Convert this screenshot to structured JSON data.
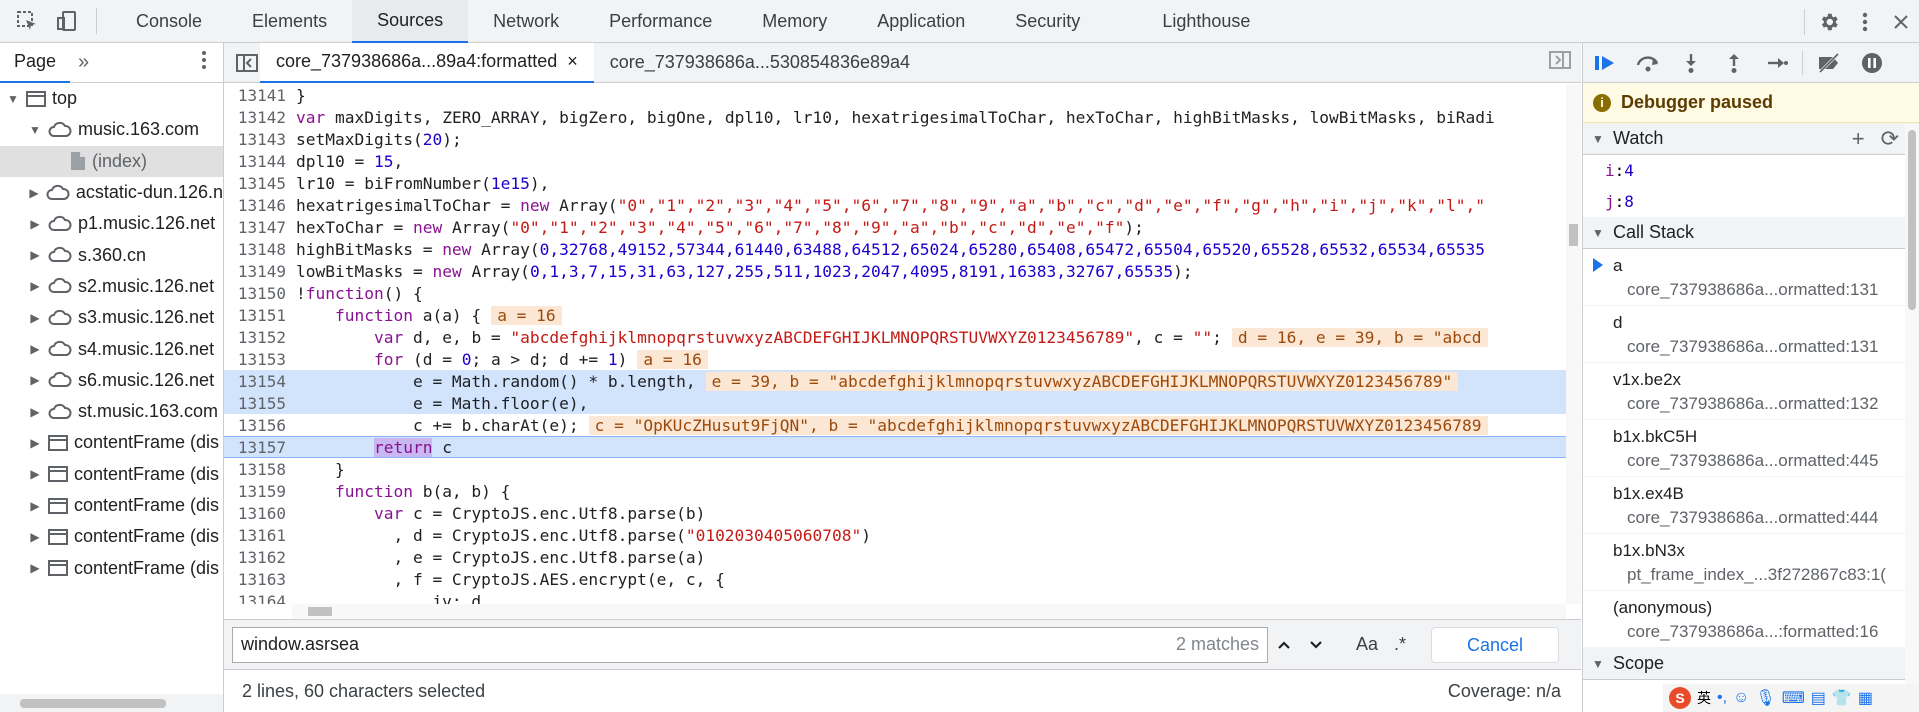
{
  "toolbar": {
    "tabs": [
      "Console",
      "Elements",
      "Sources",
      "Network",
      "Performance",
      "Memory",
      "Application",
      "Security",
      "Lighthouse"
    ],
    "active_tab": "Sources"
  },
  "navigator": {
    "tab_label": "Page",
    "more_label": "»",
    "items": [
      {
        "label": "top",
        "icon": "frame-icon",
        "expanded": true,
        "indent": 0
      },
      {
        "label": "music.163.com",
        "icon": "cloud-icon",
        "expanded": true,
        "indent": 1
      },
      {
        "label": "(index)",
        "icon": "file-icon",
        "expanded": null,
        "indent": 2
      },
      {
        "label": "acstatic-dun.126.n",
        "icon": "cloud-icon",
        "expanded": false,
        "indent": 1
      },
      {
        "label": "p1.music.126.net",
        "icon": "cloud-icon",
        "expanded": false,
        "indent": 1
      },
      {
        "label": "s.360.cn",
        "icon": "cloud-icon",
        "expanded": false,
        "indent": 1
      },
      {
        "label": "s2.music.126.net",
        "icon": "cloud-icon",
        "expanded": false,
        "indent": 1
      },
      {
        "label": "s3.music.126.net",
        "icon": "cloud-icon",
        "expanded": false,
        "indent": 1
      },
      {
        "label": "s4.music.126.net",
        "icon": "cloud-icon",
        "expanded": false,
        "indent": 1
      },
      {
        "label": "s6.music.126.net",
        "icon": "cloud-icon",
        "expanded": false,
        "indent": 1
      },
      {
        "label": "st.music.163.com",
        "icon": "cloud-icon",
        "expanded": false,
        "indent": 1
      },
      {
        "label": "contentFrame (dis",
        "icon": "frame-icon",
        "expanded": false,
        "indent": 1
      },
      {
        "label": "contentFrame (dis",
        "icon": "frame-icon",
        "expanded": false,
        "indent": 1
      },
      {
        "label": "contentFrame (dis",
        "icon": "frame-icon",
        "expanded": false,
        "indent": 1
      },
      {
        "label": "contentFrame (dis",
        "icon": "frame-icon",
        "expanded": false,
        "indent": 1
      },
      {
        "label": "contentFrame (dis",
        "icon": "frame-icon",
        "expanded": false,
        "indent": 1
      }
    ]
  },
  "editor": {
    "tabs": [
      {
        "label": "core_737938686a...89a4:formatted",
        "active": true,
        "closable": true
      },
      {
        "label": "core_737938686a...530854836e89a4",
        "active": false,
        "closable": false
      }
    ],
    "lines": [
      {
        "n": "13141",
        "segs": [
          [
            "}",
            "var"
          ]
        ]
      },
      {
        "n": "13142",
        "segs": [
          [
            "var",
            "kw"
          ],
          [
            " maxDigits, ZERO_ARRAY, bigZero, bigOne, dpl10, lr10, hexatrigesimalToChar, hexToChar, highBitMasks, lowBitMasks, biRadi",
            "var"
          ]
        ]
      },
      {
        "n": "13143",
        "segs": [
          [
            "setMaxDigits(",
            "var"
          ],
          [
            "20",
            "num"
          ],
          [
            ");",
            "var"
          ]
        ]
      },
      {
        "n": "13144",
        "segs": [
          [
            "dpl10 = ",
            "var"
          ],
          [
            "15",
            "num"
          ],
          [
            ",",
            "var"
          ]
        ]
      },
      {
        "n": "13145",
        "segs": [
          [
            "lr10 = biFromNumber(",
            "var"
          ],
          [
            "1e15",
            "num"
          ],
          [
            "),",
            "var"
          ]
        ]
      },
      {
        "n": "13146",
        "segs": [
          [
            "hexatrigesimalToChar = ",
            "var"
          ],
          [
            "new",
            "kw"
          ],
          [
            " Array(",
            "var"
          ],
          [
            "\"0\",\"1\",\"2\",\"3\",\"4\",\"5\",\"6\",\"7\",\"8\",\"9\",\"a\",\"b\",\"c\",\"d\",\"e\",\"f\",\"g\",\"h\",\"i\",\"j\",\"k\",\"l\",\"",
            "str"
          ]
        ]
      },
      {
        "n": "13147",
        "segs": [
          [
            "hexToChar = ",
            "var"
          ],
          [
            "new",
            "kw"
          ],
          [
            " Array(",
            "var"
          ],
          [
            "\"0\",\"1\",\"2\",\"3\",\"4\",\"5\",\"6\",\"7\",\"8\",\"9\",\"a\",\"b\",\"c\",\"d\",\"e\",\"f\"",
            "str"
          ],
          [
            ");",
            "var"
          ]
        ]
      },
      {
        "n": "13148",
        "segs": [
          [
            "highBitMasks = ",
            "var"
          ],
          [
            "new",
            "kw"
          ],
          [
            " Array(",
            "var"
          ],
          [
            "0,32768,49152,57344,61440,63488,64512,65024,65280,65408,65472,65504,65520,65528,65532,65534,65535",
            "num"
          ]
        ]
      },
      {
        "n": "13149",
        "segs": [
          [
            "lowBitMasks = ",
            "var"
          ],
          [
            "new",
            "kw"
          ],
          [
            " Array(",
            "var"
          ],
          [
            "0,1,3,7,15,31,63,127,255,511,1023,2047,4095,8191,16383,32767,65535",
            "num"
          ],
          [
            ");",
            "var"
          ]
        ]
      },
      {
        "n": "13150",
        "segs": [
          [
            "!",
            "var"
          ],
          [
            "function",
            "kw"
          ],
          [
            "() {",
            "var"
          ]
        ]
      },
      {
        "n": "13151",
        "segs": [
          [
            "    ",
            "var"
          ],
          [
            "function",
            "kw"
          ],
          [
            " a(a) {",
            "var"
          ]
        ],
        "inline": "a = 16"
      },
      {
        "n": "13152",
        "segs": [
          [
            "        ",
            "var"
          ],
          [
            "var",
            "kw"
          ],
          [
            " d, e, b = ",
            "var"
          ],
          [
            "\"abcdefghijklmnopqrstuvwxyzABCDEFGHIJKLMNOPQRSTUVWXYZ0123456789\"",
            "str"
          ],
          [
            ", c = ",
            "var"
          ],
          [
            "\"\"",
            "str"
          ],
          [
            ";",
            "var"
          ]
        ],
        "inline": "d = 16, e = 39, b = \"abcd"
      },
      {
        "n": "13153",
        "segs": [
          [
            "        ",
            "var"
          ],
          [
            "for",
            "kw"
          ],
          [
            " (d = ",
            "var"
          ],
          [
            "0",
            "num"
          ],
          [
            "; a > d; d += ",
            "var"
          ],
          [
            "1",
            "num"
          ],
          [
            ")",
            "var"
          ]
        ],
        "inline": "a = 16"
      },
      {
        "n": "13154",
        "segs": [
          [
            "            e = Math.random() * b.length,",
            "var"
          ]
        ],
        "inline": "e = 39, b = \"abcdefghijklmnopqrstuvwxyzABCDEFGHIJKLMNOPQRSTUVWXYZ0123456789\"",
        "hl": "partial"
      },
      {
        "n": "13155",
        "segs": [
          [
            "            e = Math.floor(e),",
            "var"
          ]
        ],
        "hl": "full"
      },
      {
        "n": "13156",
        "segs": [
          [
            "            c += b.charAt(e);",
            "var"
          ]
        ],
        "inline": "c = \"OpKUcZHusut9FjQN\", b = \"abcdefghijklmnopqrstuvwxyzABCDEFGHIJKLMNOPQRSTUVWXYZ0123456789"
      },
      {
        "n": "13157",
        "segs": [
          [
            "        ",
            "var"
          ],
          [
            "return",
            "kwhl"
          ],
          [
            " c",
            "var"
          ]
        ],
        "hl": "cur"
      },
      {
        "n": "13158",
        "segs": [
          [
            "    }",
            "var"
          ]
        ]
      },
      {
        "n": "13159",
        "segs": [
          [
            "    ",
            "var"
          ],
          [
            "function",
            "kw"
          ],
          [
            " b(a, b) {",
            "var"
          ]
        ]
      },
      {
        "n": "13160",
        "segs": [
          [
            "        ",
            "var"
          ],
          [
            "var",
            "kw"
          ],
          [
            " c = CryptoJS.enc.Utf8.parse(b)",
            "var"
          ]
        ]
      },
      {
        "n": "13161",
        "segs": [
          [
            "          , d = CryptoJS.enc.Utf8.parse(",
            "var"
          ],
          [
            "\"0102030405060708\"",
            "str"
          ],
          [
            ")",
            "var"
          ]
        ]
      },
      {
        "n": "13162",
        "segs": [
          [
            "          , e = CryptoJS.enc.Utf8.parse(a)",
            "var"
          ]
        ]
      },
      {
        "n": "13163",
        "segs": [
          [
            "          , f = CryptoJS.AES.encrypt(e, c, {",
            "var"
          ]
        ]
      },
      {
        "n": "13164",
        "segs": [
          [
            "              iv: d",
            "var"
          ]
        ]
      }
    ]
  },
  "search": {
    "value": "window.asrsea",
    "matches": "2 matches",
    "match_case_label": "Aa",
    "regex_label": ".*",
    "cancel_label": "Cancel"
  },
  "status": {
    "selection": "2 lines, 60 characters selected",
    "coverage": "Coverage: n/a"
  },
  "debugger": {
    "paused_label": "Debugger paused",
    "watch_label": "Watch",
    "watch": [
      {
        "name": "i",
        "value": "4"
      },
      {
        "name": "j",
        "value": "8"
      }
    ],
    "callstack_label": "Call Stack",
    "frames": [
      {
        "fn": "a",
        "loc": "core_737938686a...ormatted:131",
        "current": true
      },
      {
        "fn": "d",
        "loc": "core_737938686a...ormatted:131",
        "current": false
      },
      {
        "fn": "v1x.be2x",
        "loc": "core_737938686a...ormatted:132",
        "current": false
      },
      {
        "fn": "b1x.bkC5H",
        "loc": "core_737938686a...ormatted:445",
        "current": false
      },
      {
        "fn": "b1x.ex4B",
        "loc": "core_737938686a...ormatted:444",
        "current": false
      },
      {
        "fn": "b1x.bN3x",
        "loc": "pt_frame_index_...3f272867c83:1(",
        "current": false
      },
      {
        "fn": "(anonymous)",
        "loc": "core_737938686a...:formatted:16",
        "current": false
      }
    ],
    "scope_label": "Scope"
  },
  "ime": {
    "logo": "S",
    "lang": "英"
  },
  "colors": {
    "accent": "#1a73e8",
    "paused_bg": "#fffbe5",
    "inline_value_bg": "#fce6d4",
    "selection_bg": "#d2e3fc"
  }
}
